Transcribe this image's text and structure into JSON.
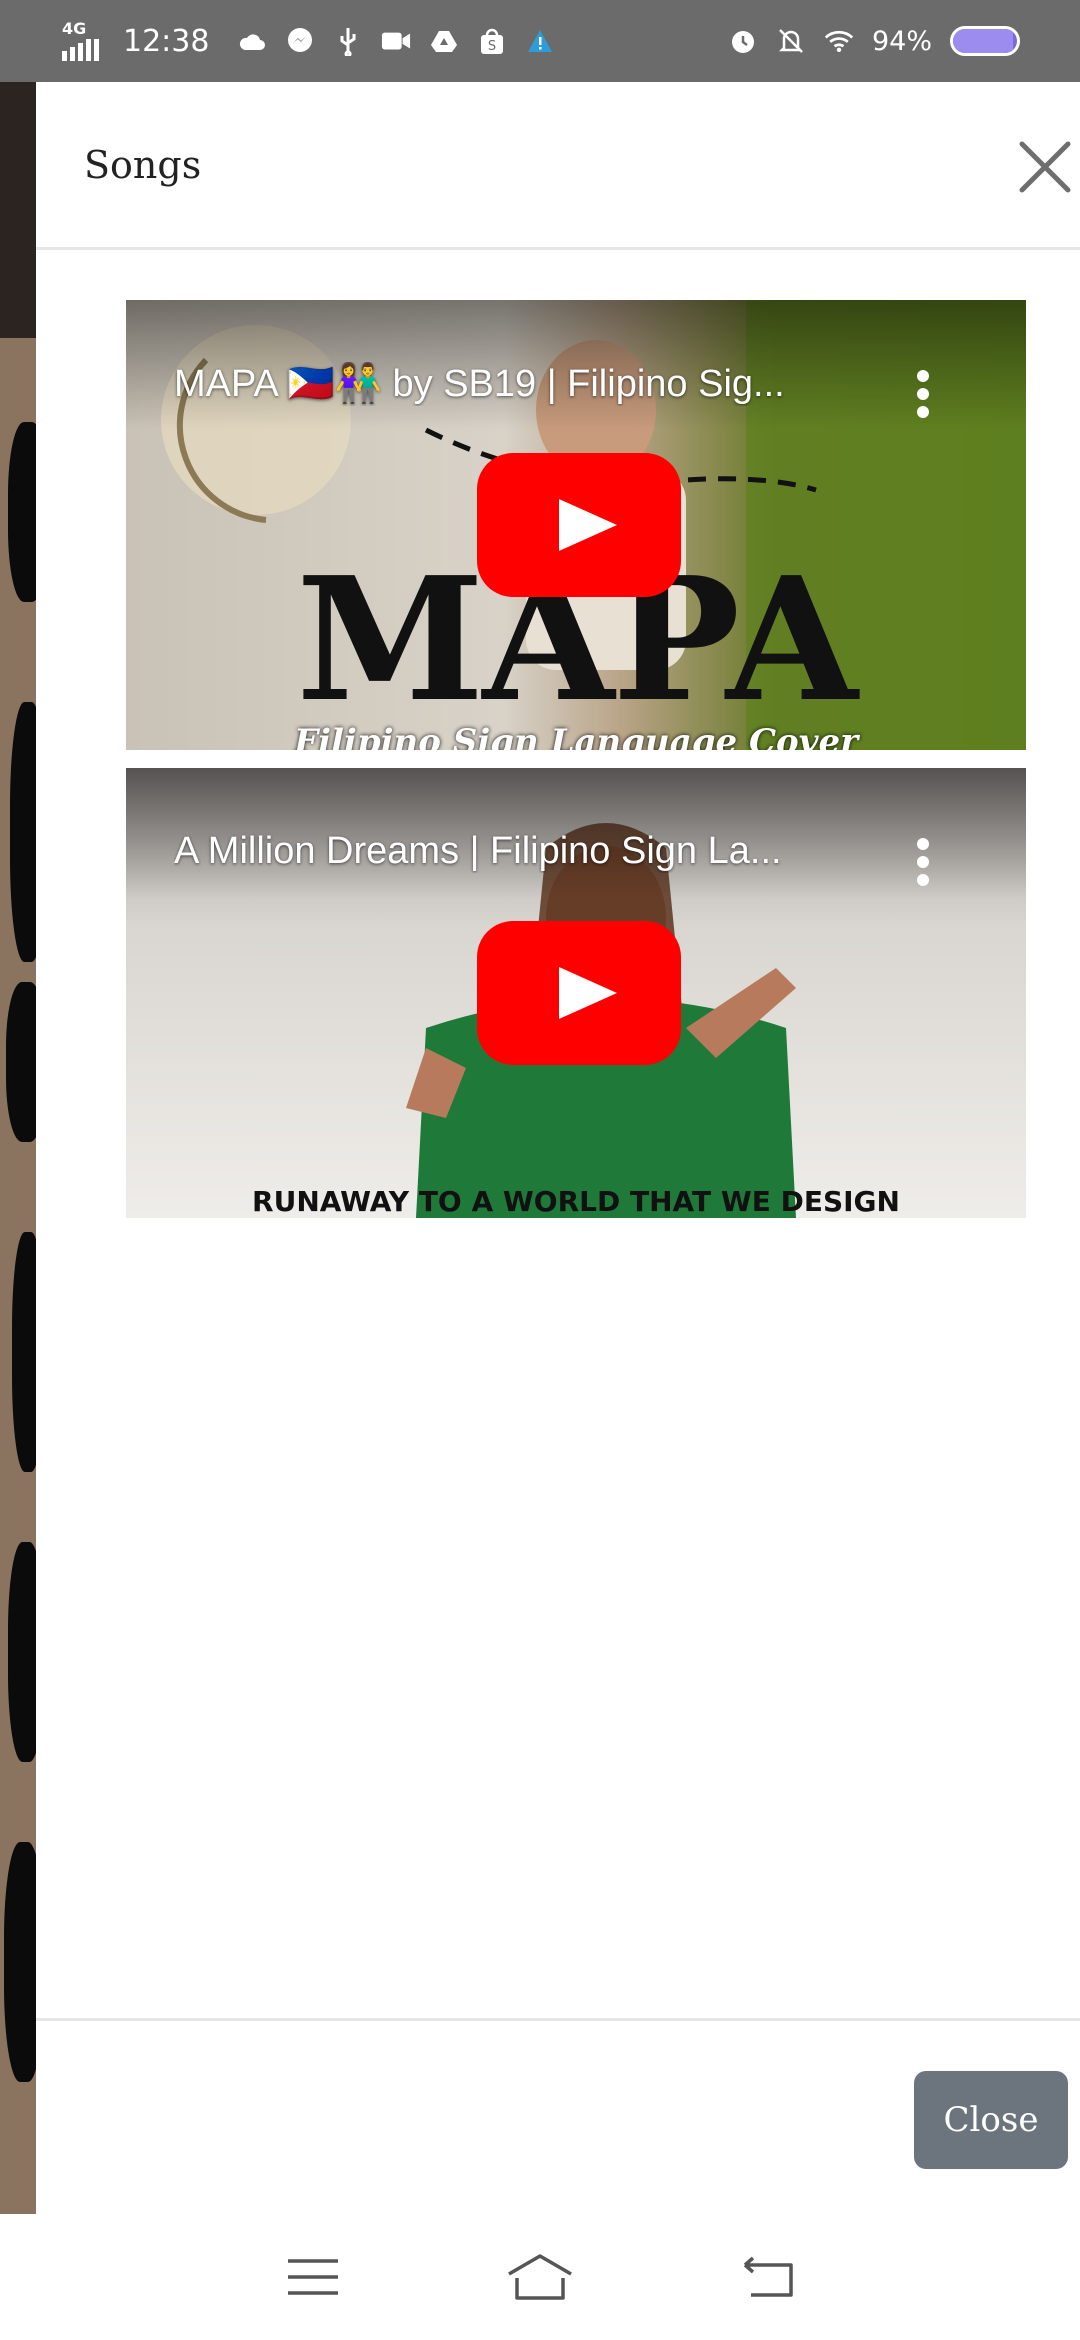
{
  "status_bar": {
    "network": "4G",
    "time": "12:38",
    "battery": "94%",
    "battery_level": 0.94,
    "left_icons": [
      "cloud-icon",
      "messenger-icon",
      "usb-icon",
      "video-icon",
      "drive-icon",
      "shopee-icon",
      "alert-icon"
    ],
    "right_icons": [
      "alarm-icon",
      "bell-off-icon",
      "wifi-icon"
    ]
  },
  "modal": {
    "title": "Songs",
    "close_icon": "close-icon",
    "videos": [
      {
        "title": "MAPA 🇵🇭👫 by SB19 | Filipino Sig...",
        "overlay_text": "MAPA",
        "caption": "Filipino Sign Language Cover",
        "menu_icon": "more-vert-icon",
        "play_icon": "youtube-play-icon"
      },
      {
        "title": "A Million Dreams | Filipino Sign La...",
        "caption": "RUNAWAY TO A WORLD THAT WE DESIGN",
        "menu_icon": "more-vert-icon",
        "play_icon": "youtube-play-icon"
      }
    ],
    "close_label": "Close"
  },
  "colors": {
    "status_bar": "#6b6b6b",
    "close_button": "#6c757d",
    "youtube_red": "#ff0000"
  },
  "nav_bar": {
    "items": [
      "menu-icon",
      "home-icon",
      "back-icon"
    ]
  }
}
